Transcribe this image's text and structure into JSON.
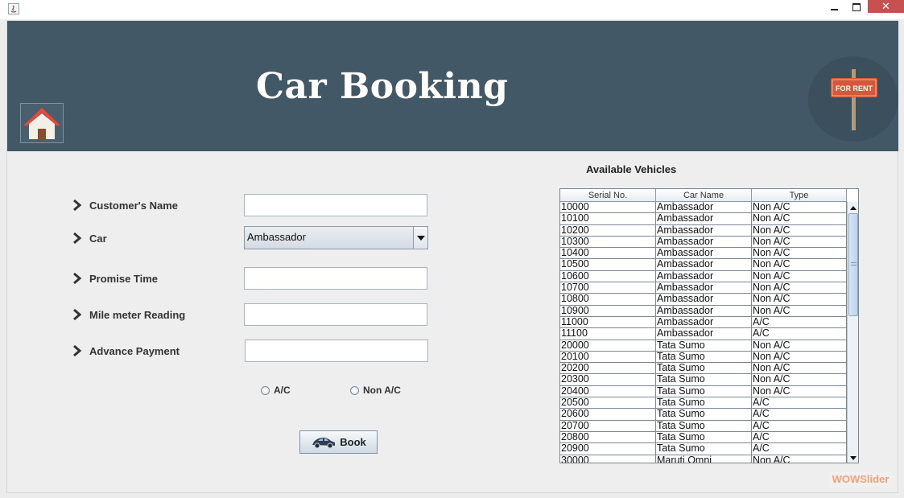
{
  "window": {
    "close_glyph": "✕"
  },
  "header": {
    "title": "Car Booking",
    "home_icon": "home-icon",
    "for_rent_sign": "FOR RENT"
  },
  "form": {
    "fields": [
      {
        "label": "Customer's Name",
        "value": ""
      },
      {
        "label": "Car",
        "value": "Ambassador"
      },
      {
        "label": "Promise Time",
        "value": ""
      },
      {
        "label": "Mile meter Reading",
        "value": ""
      },
      {
        "label": "Advance Payment",
        "value": ""
      }
    ],
    "car_selected": "Ambassador",
    "radio_ac": "A/C",
    "radio_non_ac": "Non A/C",
    "book_button": "Book"
  },
  "vehicles": {
    "title": "Available Vehicles",
    "columns": [
      "Serial No.",
      "Car Name",
      "Type"
    ],
    "rows": [
      [
        "10000",
        "Ambassador",
        "Non A/C"
      ],
      [
        "10100",
        "Ambassador",
        "Non A/C"
      ],
      [
        "10200",
        "Ambassador",
        "Non A/C"
      ],
      [
        "10300",
        "Ambassador",
        "Non A/C"
      ],
      [
        "10400",
        "Ambassador",
        "Non A/C"
      ],
      [
        "10500",
        "Ambassador",
        "Non A/C"
      ],
      [
        "10600",
        "Ambassador",
        "Non A/C"
      ],
      [
        "10700",
        "Ambassador",
        "Non A/C"
      ],
      [
        "10800",
        "Ambassador",
        "Non A/C"
      ],
      [
        "10900",
        "Ambassador",
        "Non A/C"
      ],
      [
        "11000",
        "Ambassador",
        "A/C"
      ],
      [
        "11100",
        "Ambassador",
        "A/C"
      ],
      [
        "20000",
        "Tata Sumo",
        "Non A/C"
      ],
      [
        "20100",
        "Tata Sumo",
        "Non A/C"
      ],
      [
        "20200",
        "Tata Sumo",
        "Non A/C"
      ],
      [
        "20300",
        "Tata Sumo",
        "Non A/C"
      ],
      [
        "20400",
        "Tata Sumo",
        "Non A/C"
      ],
      [
        "20500",
        "Tata Sumo",
        "A/C"
      ],
      [
        "20600",
        "Tata Sumo",
        "A/C"
      ],
      [
        "20700",
        "Tata Sumo",
        "A/C"
      ],
      [
        "20800",
        "Tata Sumo",
        "A/C"
      ],
      [
        "20900",
        "Tata Sumo",
        "A/C"
      ],
      [
        "30000",
        "Maruti Omni",
        "Non A/C"
      ]
    ]
  },
  "watermark": "WOWSlider",
  "colors": {
    "header_bg": "#435866",
    "title_color": "#ffffff",
    "close_button": "#c75050"
  }
}
